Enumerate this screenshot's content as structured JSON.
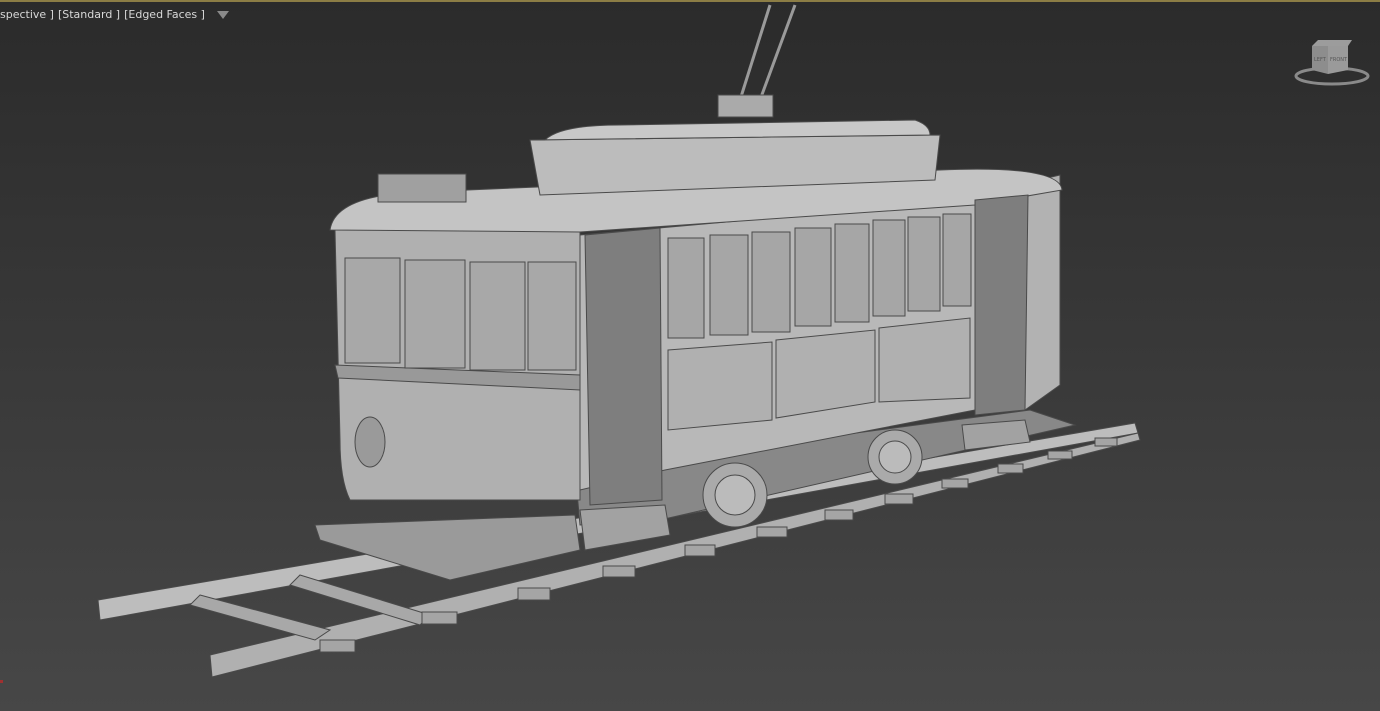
{
  "viewport": {
    "label_view": "spective ]",
    "label_shading": "[Standard ]",
    "label_mode": "[Edged Faces ]",
    "filter_icon": "filter-icon",
    "active_border_color": "#8c7d45"
  },
  "viewcube": {
    "left_face": "LEFT",
    "front_face": "FRONT"
  },
  "colors": {
    "mesh": "#b5b5b5",
    "mesh_dark": "#8a8a8a",
    "wire": "#4a4a4a"
  }
}
